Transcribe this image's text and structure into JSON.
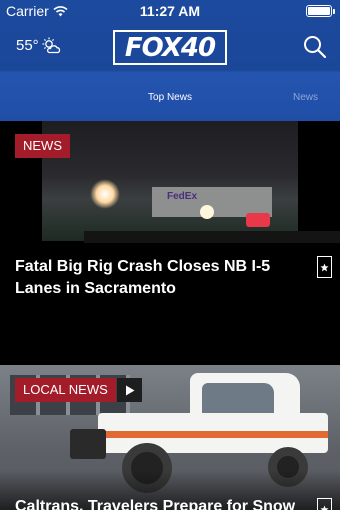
{
  "status_bar": {
    "carrier": "Carrier",
    "time": "11:27 AM"
  },
  "header": {
    "temperature": "55°",
    "weather_icon": "partly-cloudy-icon",
    "logo_text": "FOX40",
    "search_icon": "search-icon"
  },
  "tabs": [
    {
      "label": "Top News",
      "active": true
    },
    {
      "label": "News",
      "active": false
    }
  ],
  "stories": [
    {
      "category": "NEWS",
      "headline": "Fatal Big Rig Crash Closes NB I-5 Lanes in Sacramento",
      "photo_text": "FedEx",
      "has_video": false
    },
    {
      "category": "LOCAL NEWS",
      "headline": "Caltrans, Travelers Prepare for Snow",
      "has_video": true
    }
  ],
  "colors": {
    "header_blue": "#1c4a9e",
    "category_red": "#a31c2a"
  }
}
